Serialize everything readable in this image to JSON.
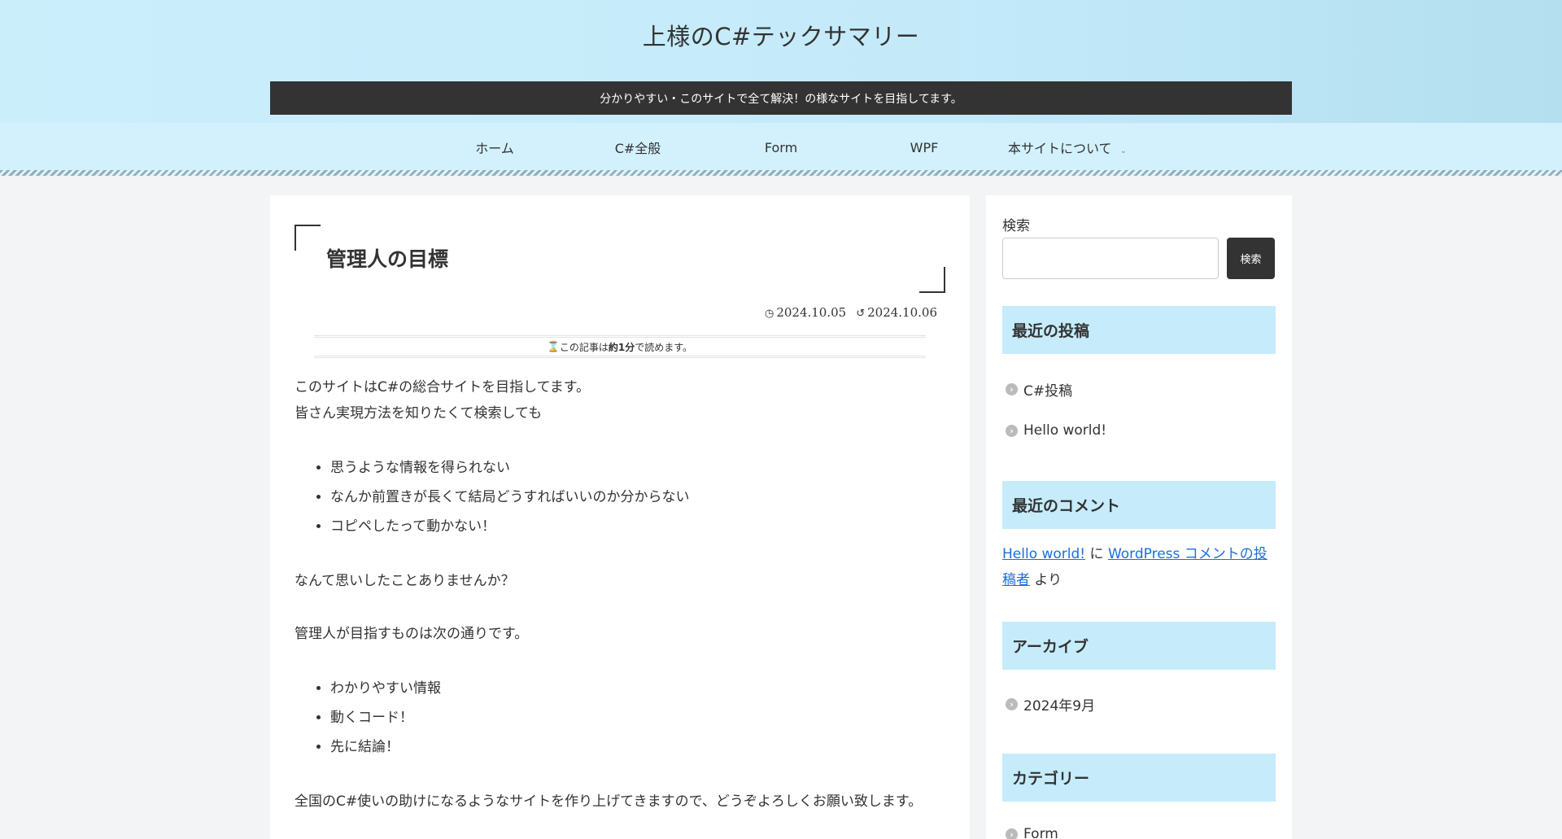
{
  "header": {
    "site_title": "上様のC#テックサマリー",
    "tagline": "分かりやすい・このサイトで全て解決！の様なサイトを目指してます。"
  },
  "nav": {
    "items": [
      "ホーム",
      "C#全般",
      "Form",
      "WPF",
      "本サイトについて"
    ]
  },
  "article": {
    "title": "管理人の目標",
    "published": "2024.10.05",
    "updated": "2024.10.06",
    "read_time": {
      "prefix": "この記事は",
      "value": "約1分",
      "suffix": "で読めます。"
    },
    "para1_line1": "このサイトはC#の総合サイトを目指してます。",
    "para1_line2": "皆さん実現方法を知りたくて検索しても",
    "list1": [
      "思うような情報を得られない",
      "なんか前置きが長くて結局どうすればいいのか分からない",
      "コピペしたって動かない！"
    ],
    "para2": "なんて思いしたことありませんか？",
    "para3": "管理人が目指すものは次の通りです。",
    "list2": [
      "わかりやすい情報",
      "動くコード！",
      "先に結論！"
    ],
    "para4": "全国のC#使いの助けになるようなサイトを作り上げてきますので、どうぞよろしくお願い致します。"
  },
  "sidebar": {
    "search_label": "検索",
    "search_value": "",
    "search_button": "検索",
    "recent_posts_title": "最近の投稿",
    "recent_posts": [
      "C#投稿",
      "Hello world!"
    ],
    "recent_comments_title": "最近のコメント",
    "comment": {
      "post_link": "Hello world!",
      "connector": "に",
      "author_link": "WordPress コメントの投稿者",
      "suffix": "より"
    },
    "archives_title": "アーカイブ",
    "archives": [
      "2024年9月"
    ],
    "categories_title": "カテゴリー",
    "categories": [
      "Form"
    ]
  },
  "colors": {
    "header_bg": "#c4eafa",
    "nav_bg": "#d2f1fd",
    "widget_title_bg": "#c6ecfb",
    "dark": "#333333",
    "link": "#1e6ed8"
  }
}
